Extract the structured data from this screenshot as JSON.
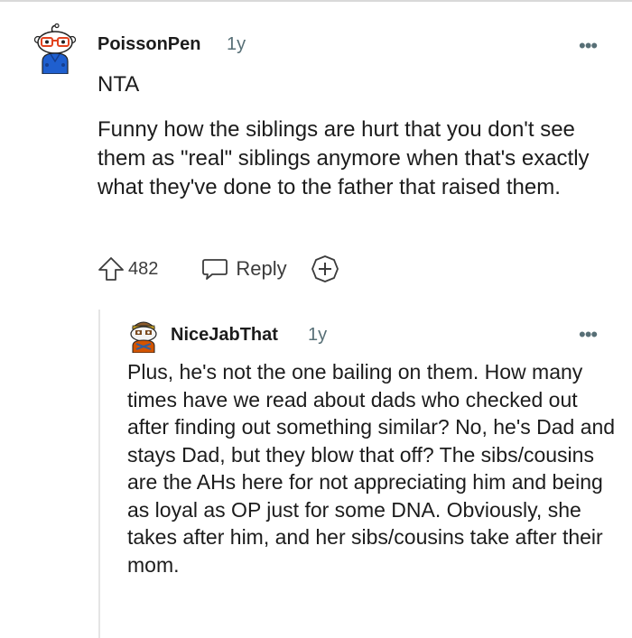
{
  "comment": {
    "author": "PoissonPen",
    "age": "1y",
    "more_label": "•••",
    "avatar_icon": "snoo-avatar-glasses",
    "paragraphs": [
      "NTA",
      "Funny how the siblings are hurt that you don't see them as \"real\" siblings anymore when that's exactly what they've done to the father that raised them."
    ],
    "upvote_icon": "upvote-arrow-icon",
    "vote_count": "482",
    "reply_label": "Reply",
    "reply_icon": "speech-bubble-icon",
    "award_icon": "award-plus-icon"
  },
  "reply": {
    "author": "NiceJabThat",
    "age": "1y",
    "more_label": "•••",
    "avatar_icon": "snoo-avatar-bandana",
    "text": "Plus, he's not the one bailing on them. How many times have we read about dads who checked out after finding out something similar? No, he's Dad and stays Dad, but they blow that off? The sibs/cousins are the AHs here for not appreciating him and being as loyal as OP just for some DNA. Obviously, she takes after him, and her sibs/cousins take after their mom."
  },
  "colors": {
    "text": "#1c1c1c",
    "meta": "#576f76",
    "action": "#3c3c3c",
    "thread_line": "#e5e5e5"
  }
}
